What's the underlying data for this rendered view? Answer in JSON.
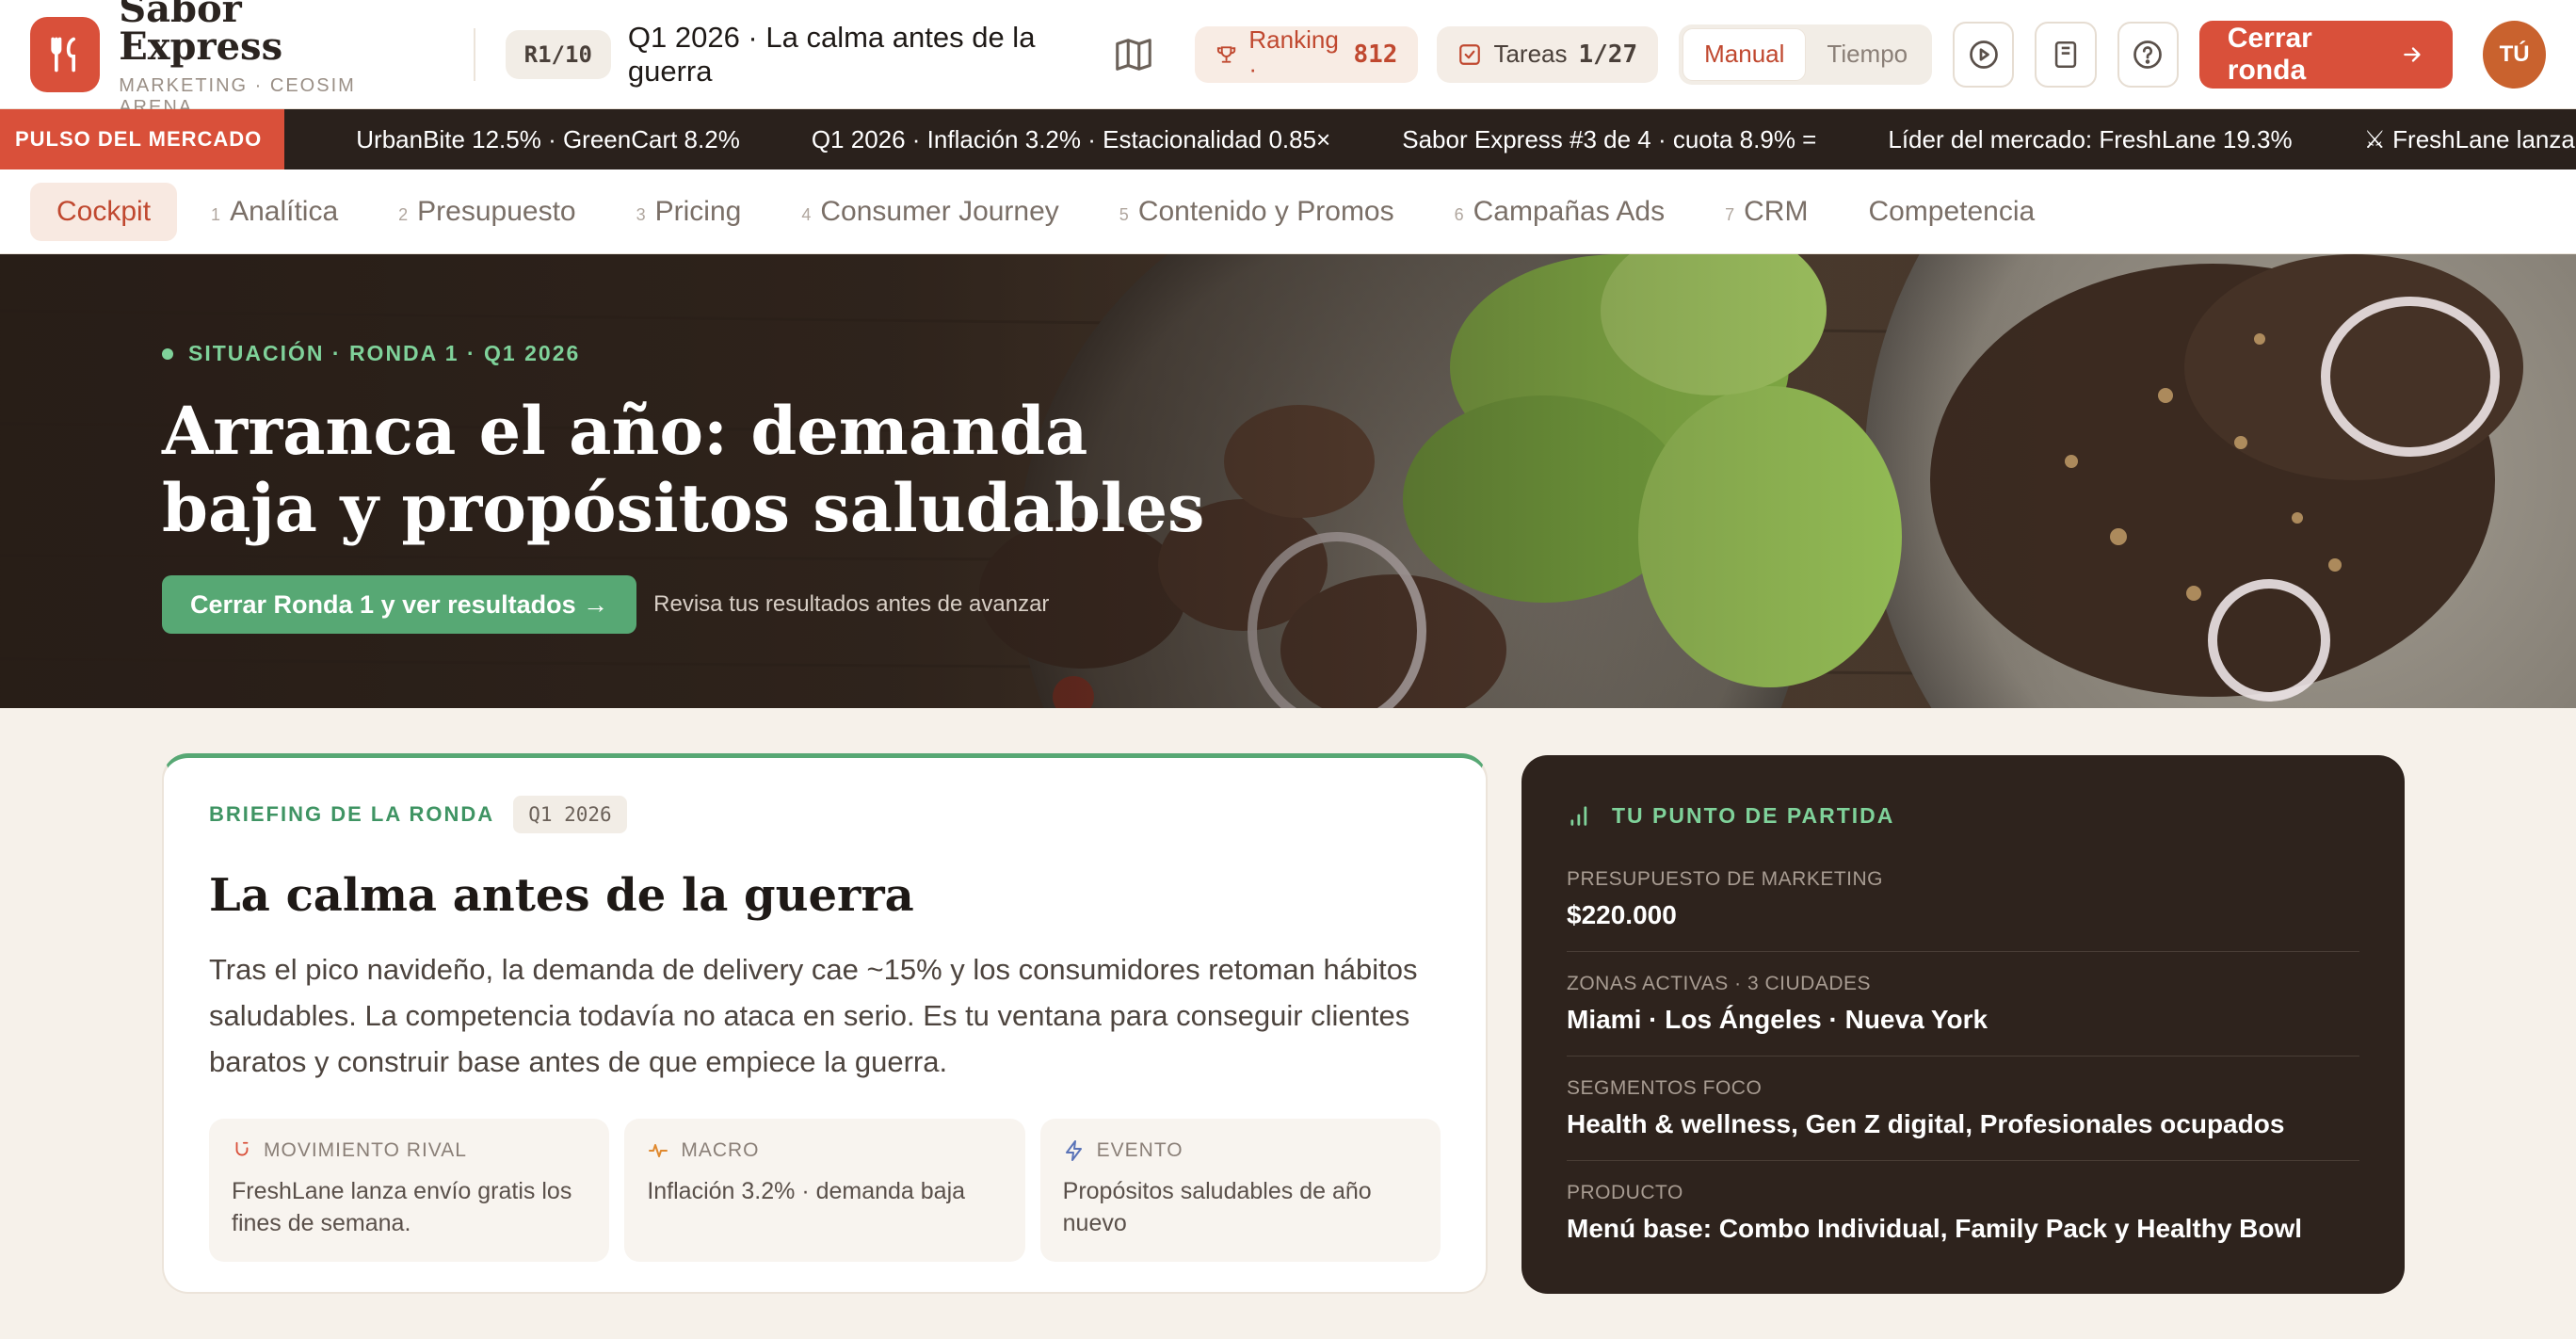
{
  "header": {
    "brand_name": "Sabor Express",
    "brand_sub": "MARKETING · CEOSIM ARENA",
    "round_chip": "R1/10",
    "round_title": "Q1 2026 · La calma antes de la guerra",
    "ranking_label": "Ranking ·",
    "ranking_value": "812",
    "tasks_label": "Tareas",
    "tasks_value": "1/27",
    "mode_manual": "Manual",
    "mode_tiempo": "Tiempo",
    "close_round": "Cerrar ronda",
    "avatar": "TÚ",
    "icons": [
      "fork-knife-icon",
      "map-icon",
      "trophy-icon",
      "checkbox-icon",
      "play-icon",
      "book-icon",
      "help-icon",
      "arrow-right-icon"
    ]
  },
  "ticker": {
    "label": "PULSO DEL MERCADO",
    "items": [
      "UrbanBite 12.5% · GreenCart 8.2%",
      "Q1 2026 · Inflación 3.2% · Estacionalidad 0.85×",
      "Sabor Express #3 de 4 · cuota 8.9% =",
      "Líder del mercado: FreshLane 19.3%",
      "⚔ FreshLane lanza envío gr"
    ]
  },
  "nav": {
    "tabs": [
      {
        "num": "",
        "label": "Cockpit",
        "active": true
      },
      {
        "num": "1",
        "label": "Analítica"
      },
      {
        "num": "2",
        "label": "Presupuesto"
      },
      {
        "num": "3",
        "label": "Pricing"
      },
      {
        "num": "4",
        "label": "Consumer Journey"
      },
      {
        "num": "5",
        "label": "Contenido y Promos"
      },
      {
        "num": "6",
        "label": "Campañas Ads"
      },
      {
        "num": "7",
        "label": "CRM"
      },
      {
        "num": "",
        "label": "Competencia"
      }
    ]
  },
  "hero": {
    "eyebrow": "SITUACIÓN · RONDA 1 · Q1 2026",
    "title": "Arranca el año: demanda baja y propósitos saludables",
    "button": "Cerrar Ronda 1 y ver resultados →",
    "hint": "Revisa tus resultados antes de avanzar"
  },
  "briefing": {
    "eyebrow": "BRIEFING DE LA RONDA",
    "chip": "Q1 2026",
    "title": "La calma antes de la guerra",
    "body": "Tras el pico navideño, la demanda de delivery cae ~15% y los consumidores retoman hábitos saludables. La competencia todavía no ataca en serio. Es tu ventana para conseguir clientes baratos y construir base antes de que empiece la guerra.",
    "tiles": [
      {
        "label": "MOVIMIENTO RIVAL",
        "text": "FreshLane lanza envío gratis los fines de semana.",
        "icon": "magnet-icon",
        "color": "#d9503a"
      },
      {
        "label": "MACRO",
        "text": "Inflación 3.2% · demanda baja",
        "icon": "pulse-icon",
        "color": "#e0892e"
      },
      {
        "label": "EVENTO",
        "text": "Propósitos saludables de año nuevo",
        "icon": "bolt-icon",
        "color": "#5b74b8"
      }
    ]
  },
  "starting_point": {
    "title": "TU PUNTO DE PARTIDA",
    "rows": [
      {
        "key": "PRESUPUESTO DE MARKETING",
        "value": "$220.000"
      },
      {
        "key": "ZONAS ACTIVAS · 3 CIUDADES",
        "value": "Miami · Los Ángeles · Nueva York"
      },
      {
        "key": "SEGMENTOS FOCO",
        "value": "Health & wellness, Gen Z digital, Profesionales ocupados"
      },
      {
        "key": "PRODUCTO",
        "value": "Menú base: Combo Individual, Family Pack y Healthy Bowl"
      }
    ]
  },
  "colors": {
    "brand": "#d9503a",
    "green": "#57a874",
    "dark": "#2e231d",
    "ticker_bg": "#2a211c"
  }
}
